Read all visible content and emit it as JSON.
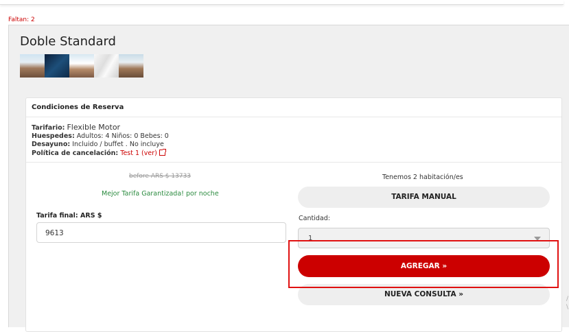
{
  "status": {
    "faltan": "Faltan: 2"
  },
  "room": {
    "title": "Doble Standard",
    "photos": [
      "room-photo",
      "night-city-photo",
      "room-photo",
      "curtain-photo",
      "room-photo"
    ]
  },
  "card": {
    "title": "Condiciones de Reserva",
    "tarifario_label": "Tarifario:",
    "tarifario_value": "Flexible Motor",
    "huespedes_label": "Huespedes:",
    "huespedes_value": "Adultos: 4 Niños: 0 Bebes: 0",
    "desayuno_label": "Desayuno:",
    "desayuno_value": "Incluido / buffet . No incluye",
    "cancelacion_label": "Política de cancelación:",
    "cancelacion_value": "Test 1 (ver)"
  },
  "pricing": {
    "before": "before ARS $ 13733",
    "mejor_tarifa": "Mejor Tarifa Garantizada! por noche",
    "tarifa_final_label": "Tarifa final: ARS $",
    "tarifa_final_value": "9613"
  },
  "booking": {
    "availability": "Tenemos 2 habitación/es",
    "tarifa_manual_label": "TARIFA MANUAL",
    "cantidad_label": "Cantidad:",
    "cantidad_value": "1",
    "agregar_label": "AGREGAR »",
    "nueva_consulta_label": "NUEVA CONSULTA »"
  },
  "colors": {
    "accent": "#cc0000",
    "highlight": "#e01010",
    "success_text": "#2a8a3e",
    "button_gray": "#eeeeee"
  }
}
